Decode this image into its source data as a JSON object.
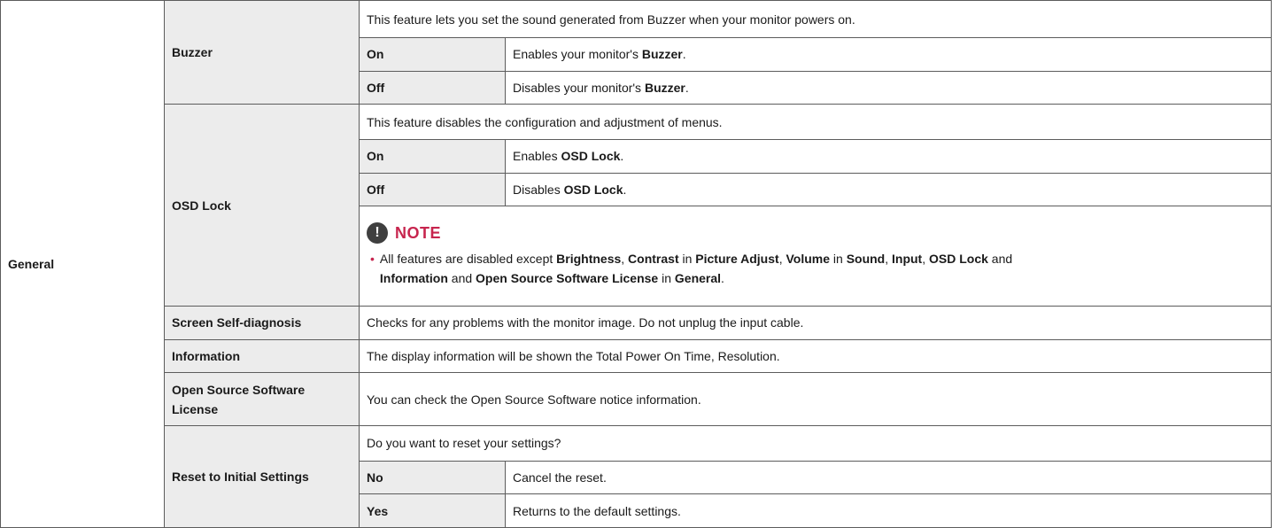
{
  "category": "General",
  "buzzer": {
    "label": "Buzzer",
    "intro": "This feature lets you set the sound generated from Buzzer when your monitor powers on.",
    "options": [
      {
        "name": "On",
        "pre": "Enables your monitor's ",
        "bold": "Buzzer",
        "post": "."
      },
      {
        "name": "Off",
        "pre": "Disables your monitor's ",
        "bold": "Buzzer",
        "post": "."
      }
    ]
  },
  "osd_lock": {
    "label": "OSD Lock",
    "intro": "This feature disables the configuration and adjustment of menus.",
    "options": [
      {
        "name": "On",
        "pre": "Enables ",
        "bold": "OSD Lock",
        "post": "."
      },
      {
        "name": "Off",
        "pre": "Disables ",
        "bold": "OSD Lock",
        "post": "."
      }
    ],
    "note": {
      "title": "NOTE",
      "bullet": "•",
      "parts": [
        {
          "t": "All features are disabled except "
        },
        {
          "t": "Brightness",
          "b": true
        },
        {
          "t": ", "
        },
        {
          "t": "Contrast",
          "b": true
        },
        {
          "t": " in "
        },
        {
          "t": "Picture Adjust",
          "b": true
        },
        {
          "t": ", "
        },
        {
          "t": "Volume",
          "b": true
        },
        {
          "t": " in "
        },
        {
          "t": "Sound",
          "b": true
        },
        {
          "t": ", "
        },
        {
          "t": "Input",
          "b": true
        },
        {
          "t": ", "
        },
        {
          "t": "OSD Lock",
          "b": true
        },
        {
          "t": " and "
        },
        {
          "t": "Information",
          "b": true
        },
        {
          "t": " and "
        },
        {
          "t": "Open Source Software License",
          "b": true
        },
        {
          "t": " in "
        },
        {
          "t": "General",
          "b": true
        },
        {
          "t": "."
        }
      ]
    }
  },
  "self_diag": {
    "label": "Screen Self-diagnosis",
    "desc": "Checks for any problems with the monitor image. Do not unplug the input cable."
  },
  "information": {
    "label": "Information",
    "desc": "The display information will be shown the Total Power On Time, Resolution."
  },
  "oss": {
    "label": "Open Source Software License",
    "desc": "You can check the Open Source Software notice information."
  },
  "reset": {
    "label": "Reset to Initial Settings",
    "intro": "Do you want to reset your settings?",
    "options": [
      {
        "name": "No",
        "desc": "Cancel the reset."
      },
      {
        "name": "Yes",
        "desc": "Returns to the default settings."
      }
    ]
  }
}
